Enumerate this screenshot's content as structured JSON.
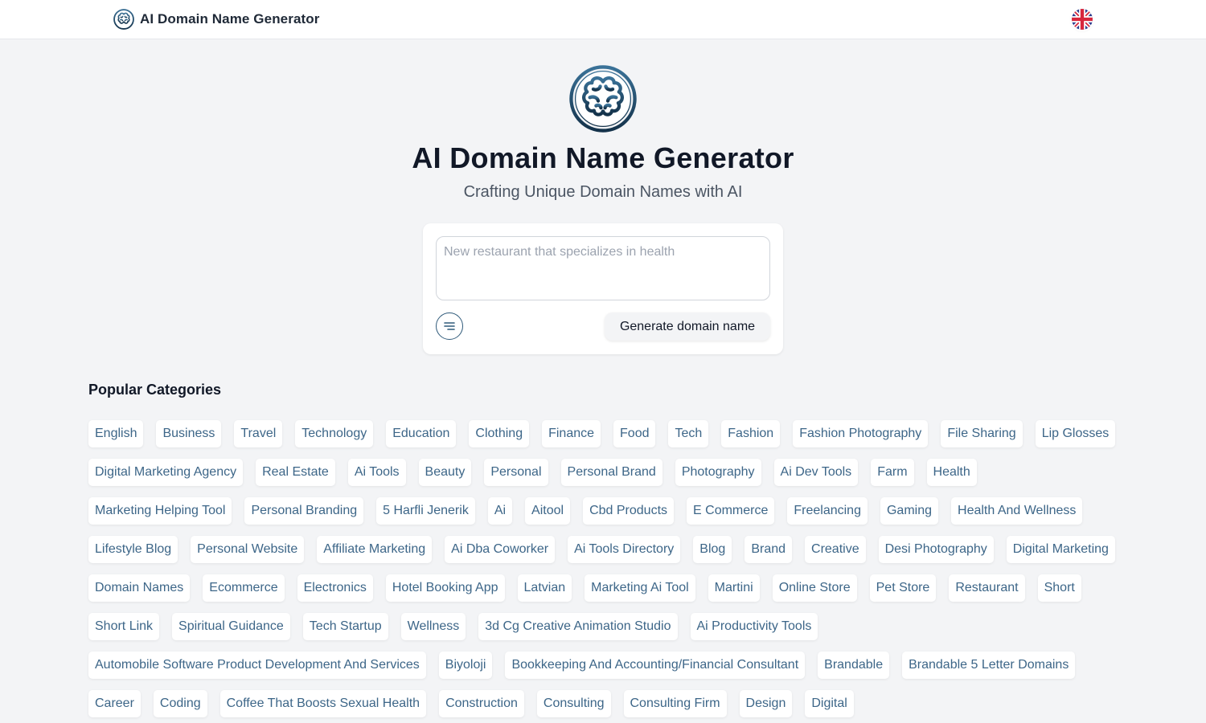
{
  "header": {
    "brand_name": "AI Domain Name Generator",
    "logo_icon": "brain-icon",
    "language_icon": "uk-flag-icon"
  },
  "hero": {
    "logo_icon": "brain-icon",
    "title": "AI Domain Name Generator",
    "subtitle": "Crafting Unique Domain Names with AI"
  },
  "search": {
    "placeholder": "New restaurant that specializes in health",
    "value": "",
    "options_icon": "filter-lines-icon",
    "generate_label": "Generate domain name"
  },
  "categories": {
    "title": "Popular Categories",
    "items": [
      "English",
      "Business",
      "Travel",
      "Technology",
      "Education",
      "Clothing",
      "Finance",
      "Food",
      "Tech",
      "Fashion",
      "Fashion Photography",
      "File Sharing",
      "Lip Glosses",
      "Digital Marketing Agency",
      "Real Estate",
      "Ai Tools",
      "Beauty",
      "Personal",
      "Personal Brand",
      "Photography",
      "Ai Dev Tools",
      "Farm",
      "Health",
      "Marketing Helping Tool",
      "Personal Branding",
      "5 Harfli Jenerik",
      "Ai",
      "Aitool",
      "Cbd Products",
      "E Commerce",
      "Freelancing",
      "Gaming",
      "Health And Wellness",
      "Lifestyle Blog",
      "Personal Website",
      "Affiliate Marketing",
      "Ai Dba Coworker",
      "Ai Tools Directory",
      "Blog",
      "Brand",
      "Creative",
      "Desi Photography",
      "Digital Marketing",
      "Domain Names",
      "Ecommerce",
      "Electronics",
      "Hotel Booking App",
      "Latvian",
      "Marketing Ai Tool",
      "Martini",
      "Online Store",
      "Pet Store",
      "Restaurant",
      "Short",
      "Short Link",
      "Spiritual Guidance",
      "Tech Startup",
      "Wellness",
      "3d Cg Creative Animation Studio",
      "Ai Productivity Tools",
      "Automobile Software Product Development And Services",
      "Biyoloji",
      "Bookkeeping And Accounting/Financial Consultant",
      "Brandable",
      "Brandable 5 Letter Domains",
      "Career",
      "Coding",
      "Coffee That Boosts Sexual Health",
      "Construction",
      "Consulting",
      "Consulting Firm",
      "Design",
      "Digital"
    ]
  },
  "colors": {
    "page_background": "#f3f4f6",
    "tag_text": "#3d6688",
    "brand_dark": "#1e4a6b",
    "title_text": "#111827"
  }
}
